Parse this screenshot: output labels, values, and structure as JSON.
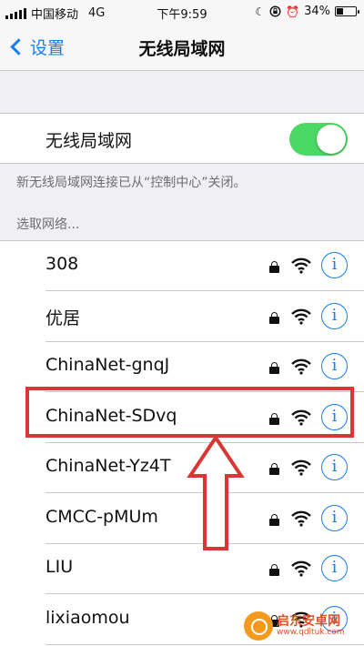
{
  "status_bar": {
    "carrier": "中国移动",
    "network": "4G",
    "time": "下午9:59",
    "battery_percent": "34%",
    "battery_level": 0.34,
    "icons": [
      "signal-bars-icon",
      "moon-icon",
      "rotation-lock-icon",
      "alarm-icon",
      "battery-icon"
    ]
  },
  "nav": {
    "back_label": "设置",
    "title": "无线局域网"
  },
  "wifi_toggle": {
    "label": "无线局域网",
    "on": true
  },
  "info_note": "新无线局域网连接已从“控制中心”关闭。",
  "section_header": "选取网络...",
  "networks": [
    {
      "name": "308"
    },
    {
      "name": "优居"
    },
    {
      "name": "ChinaNet-gnqJ"
    },
    {
      "name": "ChinaNet-SDvq"
    },
    {
      "name": "ChinaNet-Yz4T"
    },
    {
      "name": "CMCC-pMUm"
    },
    {
      "name": "LIU"
    },
    {
      "name": "lixiaomou"
    }
  ],
  "colors": {
    "accent": "#1a7cf5",
    "toggle_on": "#4cd864",
    "annotation": "#d93636"
  },
  "watermark": {
    "title": "启东安卓网",
    "url": "www.qdltuk.com"
  }
}
